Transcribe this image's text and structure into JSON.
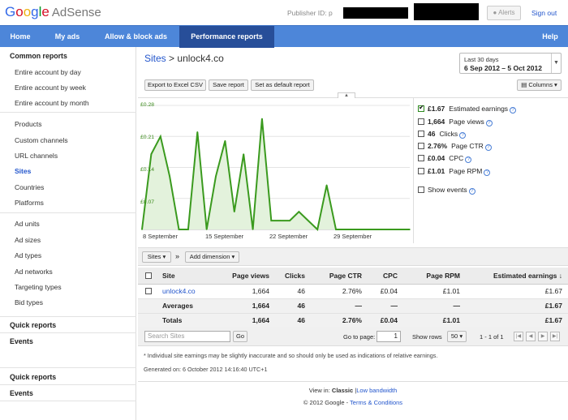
{
  "header": {
    "logo_google": "Google",
    "logo_product": "AdSense",
    "publisher_label": "Publisher ID: p",
    "alerts_label": "Alerts",
    "signout_label": "Sign out"
  },
  "nav": {
    "items": [
      "Home",
      "My ads",
      "Allow & block ads",
      "Performance reports"
    ],
    "help_label": "Help",
    "active": "Performance reports"
  },
  "sidebar": {
    "common_reports_heading": "Common reports",
    "group1": [
      "Entire account by day",
      "Entire account by week",
      "Entire account by month"
    ],
    "group2": [
      "Products",
      "Custom channels",
      "URL channels",
      "Sites",
      "Countries",
      "Platforms"
    ],
    "group3": [
      "Ad units",
      "Ad sizes",
      "Ad types",
      "Ad networks",
      "Targeting types",
      "Bid types"
    ],
    "selected": "Sites",
    "quick_reports_1": "Quick reports",
    "events_1": "Events",
    "quick_reports_2": "Quick reports",
    "events_2": "Events"
  },
  "main": {
    "breadcrumb_link": "Sites",
    "breadcrumb_sep": ">",
    "breadcrumb_current": "unlock4.co",
    "date_range_label": "Last 30 days",
    "date_range_value": "6 Sep 2012 – 5 Oct 2012",
    "buttons": {
      "export": "Export to Excel CSV",
      "save": "Save report",
      "default": "Set as default report",
      "columns": "Columns"
    }
  },
  "chart_data": {
    "type": "area",
    "color": "#3a9a1e",
    "fill": "#e3f2dc",
    "y_ticks": [
      "£0.28",
      "£0.21",
      "£0.14",
      "£0.07"
    ],
    "ylim": [
      0,
      0.28
    ],
    "x_ticks": [
      "8 September",
      "15 September",
      "22 September",
      "29 September"
    ],
    "values": [
      0.0,
      0.17,
      0.21,
      0.12,
      0.0,
      0.0,
      0.22,
      0.0,
      0.12,
      0.2,
      0.04,
      0.17,
      0.0,
      0.25,
      0.02,
      0.02,
      0.02,
      0.04,
      0.02,
      0.0,
      0.1,
      0.0,
      0.0,
      0.0,
      0.0,
      0.0,
      0.0,
      0.0,
      0.0,
      0.0
    ]
  },
  "metrics": [
    {
      "value": "£1.67",
      "label": "Estimated earnings",
      "checked": true
    },
    {
      "value": "1,664",
      "label": "Page views",
      "checked": false
    },
    {
      "value": "46",
      "label": "Clicks",
      "checked": false
    },
    {
      "value": "2.76%",
      "label": "Page CTR",
      "checked": false
    },
    {
      "value": "£0.04",
      "label": "CPC",
      "checked": false
    },
    {
      "value": "£1.01",
      "label": "Page RPM",
      "checked": false
    }
  ],
  "show_events_label": "Show events",
  "table_toolbar": {
    "dimension_select": "Sites",
    "arrows": "»",
    "add_dimension": "Add dimension"
  },
  "table": {
    "headers": [
      "Site",
      "Page views",
      "Clicks",
      "Page CTR",
      "CPC",
      "Page RPM",
      "Estimated earnings"
    ],
    "sort_indicator": "↓",
    "row": {
      "site": "unlock4.co",
      "page_views": "1,664",
      "clicks": "46",
      "ctr": "2.76%",
      "cpc": "£0.04",
      "rpm": "£1.01",
      "earnings": "£1.67"
    },
    "averages": {
      "label": "Averages",
      "page_views": "1,664",
      "clicks": "46",
      "ctr": "—",
      "cpc": "—",
      "rpm": "—",
      "earnings": "£1.67"
    },
    "totals": {
      "label": "Totals",
      "page_views": "1,664",
      "clicks": "46",
      "ctr": "2.76%",
      "cpc": "£0.04",
      "rpm": "£1.01",
      "earnings": "£1.67"
    }
  },
  "pager": {
    "search_placeholder": "Search Sites",
    "go_label": "Go",
    "goto_label": "Go to page:",
    "page_value": "1",
    "show_rows_label": "Show rows",
    "rows_value": "50",
    "range_text": "1 - 1 of 1"
  },
  "footnote": "* Individual site earnings may be slightly inaccurate and so should only be used as indications of relative earnings.",
  "generated": "Generated on: 6 October 2012 14:16:40 UTC+1",
  "footer": {
    "view_in": "View in:",
    "classic": "Classic",
    "sep": "|",
    "low_bandwidth": "Low bandwidth",
    "copyright": "© 2012 Google -",
    "terms": "Terms & Conditions"
  }
}
